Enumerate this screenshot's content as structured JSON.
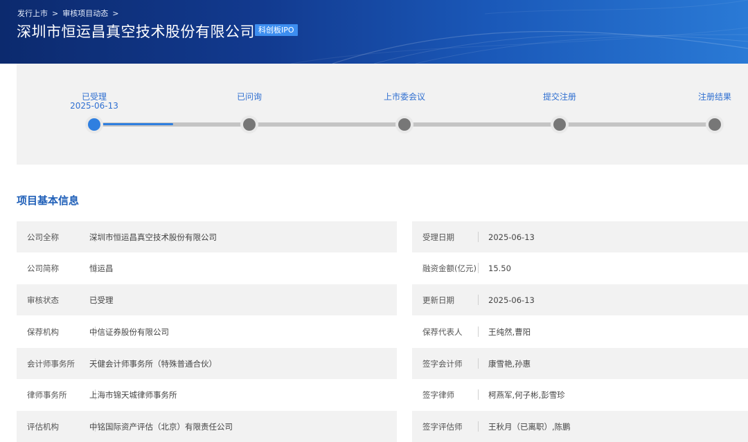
{
  "breadcrumb": {
    "item1": "发行上市",
    "item2": "审核项目动态",
    "sep": ">"
  },
  "header": {
    "company_name": "深圳市恒运昌真空技术股份有限公司",
    "board_badge": "科创板IPO"
  },
  "progress": {
    "steps": [
      {
        "label": "已受理",
        "date": "2025-06-13",
        "active": true
      },
      {
        "label": "已问询",
        "date": "",
        "active": false
      },
      {
        "label": "上市委会议",
        "date": "",
        "active": false
      },
      {
        "label": "提交注册",
        "date": "",
        "active": false
      },
      {
        "label": "注册结果",
        "date": "",
        "active": false
      }
    ],
    "fill_fraction": 0.127
  },
  "section": {
    "title": "项目基本信息"
  },
  "info": {
    "left": [
      {
        "key": "公司全称",
        "value": "深圳市恒运昌真空技术股份有限公司"
      },
      {
        "key": "公司简称",
        "value": "恒运昌"
      },
      {
        "key": "审核状态",
        "value": "已受理"
      },
      {
        "key": "保荐机构",
        "value": "中信证券股份有限公司"
      },
      {
        "key": "会计师事务所",
        "value": "天健会计师事务所（特殊普通合伙）"
      },
      {
        "key": "律师事务所",
        "value": "上海市锦天城律师事务所"
      },
      {
        "key": "评估机构",
        "value": "中铭国际资产评估（北京）有限责任公司"
      }
    ],
    "right": [
      {
        "key": "受理日期",
        "value": "2025-06-13"
      },
      {
        "key": "融资金额(亿元)",
        "value": "15.50"
      },
      {
        "key": "更新日期",
        "value": "2025-06-13"
      },
      {
        "key": "保荐代表人",
        "value": "王纯然,曹阳"
      },
      {
        "key": "签字会计师",
        "value": "康雪艳,孙惠"
      },
      {
        "key": "签字律师",
        "value": "柯燕军,何子彬,彭雪珍"
      },
      {
        "key": "签字评估师",
        "value": "王秋月（已离职）,陈鹏"
      }
    ]
  },
  "colors": {
    "accent": "#2f7fe0",
    "title_blue": "#1f5fb8",
    "banner_dark": "#0c2a6e"
  }
}
